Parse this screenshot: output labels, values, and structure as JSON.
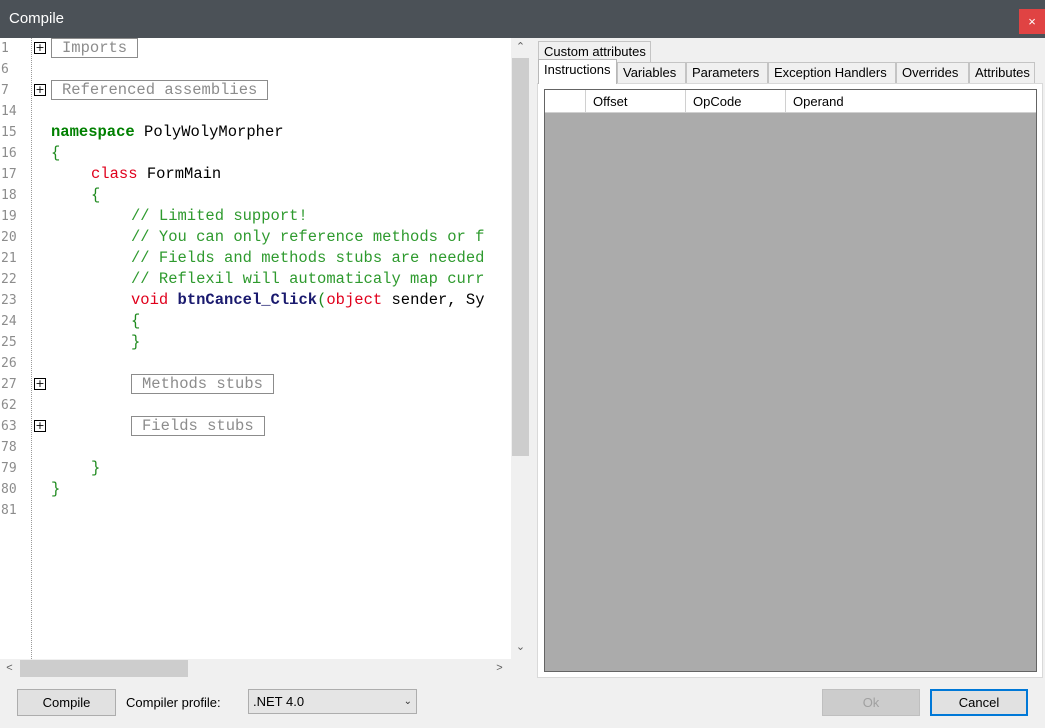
{
  "window": {
    "title": "Compile",
    "close_label": "×"
  },
  "editor": {
    "lines": [
      {
        "num": "1",
        "expander": "+",
        "collapsed": "Imports"
      },
      {
        "num": "6"
      },
      {
        "num": "7",
        "expander": "+",
        "collapsed": "Referenced assemblies"
      },
      {
        "num": "14"
      },
      {
        "num": "15",
        "kw": "namespace",
        "text": " PolyWolyMorpher"
      },
      {
        "num": "16",
        "brace": "{"
      },
      {
        "num": "17",
        "kw2": "class",
        "text": " FormMain"
      },
      {
        "num": "18",
        "brace": "{"
      },
      {
        "num": "19",
        "comment": "// Limited support!"
      },
      {
        "num": "20",
        "comment": "// You can only reference methods or f"
      },
      {
        "num": "21",
        "comment": "// Fields and methods stubs are needed"
      },
      {
        "num": "22",
        "comment": "// Reflexil will automaticaly map curr"
      },
      {
        "num": "23",
        "kw2": "void",
        "method": "btnCancel_Click",
        "paren": "(",
        "kw3": "object",
        "text": " sender, Sy"
      },
      {
        "num": "24",
        "brace": "{"
      },
      {
        "num": "25",
        "brace": "}"
      },
      {
        "num": "26"
      },
      {
        "num": "27",
        "expander": "+",
        "collapsed": "Methods stubs"
      },
      {
        "num": "62"
      },
      {
        "num": "63",
        "expander": "+",
        "collapsed": "Fields stubs"
      },
      {
        "num": "78"
      },
      {
        "num": "79",
        "brace": "}"
      },
      {
        "num": "80",
        "brace": "}"
      },
      {
        "num": "81"
      }
    ],
    "scroll_up": "⌃",
    "scroll_down": "⌄",
    "scroll_left": "<",
    "scroll_right": ">"
  },
  "tabs": {
    "top": "Custom attributes",
    "row": [
      "Instructions",
      "Variables",
      "Parameters",
      "Exception Handlers",
      "Overrides",
      "Attributes"
    ],
    "active": "Instructions"
  },
  "grid": {
    "columns": [
      "",
      "Offset",
      "OpCode",
      "Operand"
    ]
  },
  "footer": {
    "compile_label": "Compile",
    "profile_label": "Compiler profile:",
    "profile_value": ".NET 4.0",
    "ok_label": "Ok",
    "cancel_label": "Cancel"
  },
  "colors": {
    "titlebar": "#4b5157",
    "close": "#e04343",
    "keyword_green": "#008000",
    "keyword_red": "#e0001c",
    "comment": "#2e9a2e",
    "accent": "#0078d7",
    "grid_bg": "#ababab"
  }
}
